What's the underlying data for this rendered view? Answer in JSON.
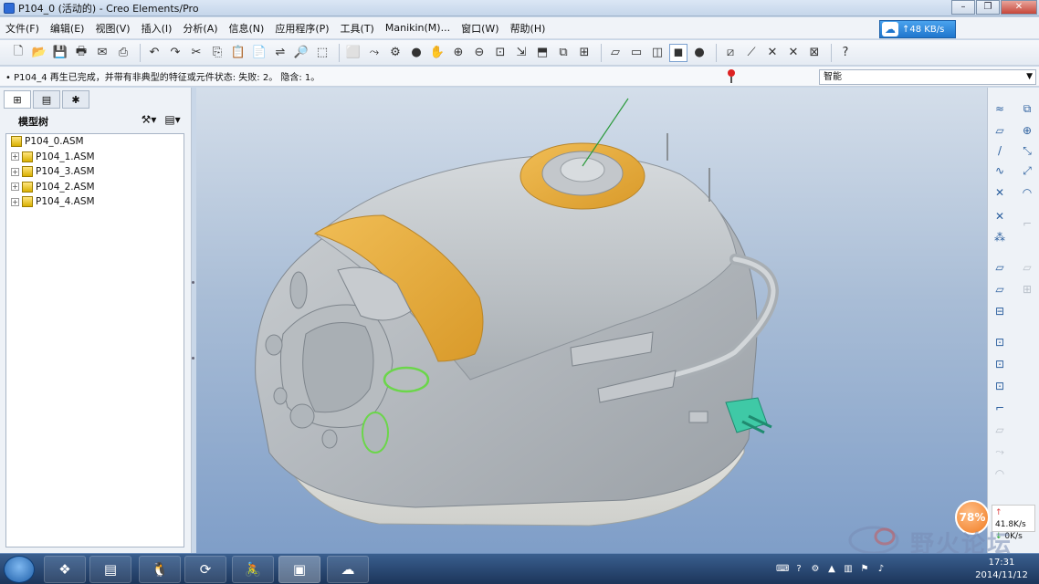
{
  "window": {
    "title": "P104_0 (活动的) - Creo Elements/Pro",
    "ghost_title": "一 □ × 文件 ... 帮助"
  },
  "menu": [
    "文件(F)",
    "编辑(E)",
    "视图(V)",
    "插入(I)",
    "分析(A)",
    "信息(N)",
    "应用程序(P)",
    "工具(T)",
    "Manikin(M)...",
    "窗口(W)",
    "帮助(H)"
  ],
  "net_widget": {
    "speed": "48 KB/s",
    "arrow": "↑"
  },
  "toolbar": {
    "buttons_a": [
      "🗋",
      "📂",
      "💾",
      "🖶",
      "✉",
      "⎙"
    ],
    "buttons_b": [
      "↶",
      "↷",
      "✂",
      "⎘",
      "📋",
      "📄",
      "⇌",
      "🔎",
      "⬚"
    ],
    "buttons_c": [
      "⬜",
      "⤳",
      "⚙",
      "●",
      "✋",
      "⊕",
      "⊖",
      "⊡",
      "⇲",
      "⬒",
      "⧉",
      "⊞"
    ],
    "buttons_d": [
      "▱",
      "▭",
      "◫",
      "◼",
      "●"
    ],
    "buttons_e": [
      "⧄",
      "⟋",
      "✕",
      "✕",
      "⊠",
      "?"
    ]
  },
  "status": {
    "message": "• P104_4 再生已完成，并带有非典型的特征或元件状态: 失败: 2。 隐含: 1。",
    "filter_value": "智能"
  },
  "model_tree": {
    "title": "模型树",
    "root": "P104_0.ASM",
    "children": [
      "P104_1.ASM",
      "P104_3.ASM",
      "P104_2.ASM",
      "P104_4.ASM"
    ]
  },
  "right_toolbar": {
    "col1": [
      "≈",
      "▱",
      "/",
      "∿",
      "✕",
      "✕",
      "⁂",
      "▱",
      "▱",
      "⊟",
      "⊡",
      "⊡",
      "⊡",
      "⌐",
      "▱",
      "⤳",
      "◠"
    ],
    "col2": [
      "⧉",
      "⊕",
      "⤡",
      "⤢",
      "◠",
      "⌐",
      "▱",
      "⊞"
    ]
  },
  "speed_widget": {
    "percent": "78%",
    "up": "41.8K/s",
    "down": "0K/s"
  },
  "watermark": {
    "text": "野火论坛"
  },
  "taskbar": {
    "apps": [
      "❖",
      "▤",
      "🐧",
      "⟳",
      "🚴",
      "▣",
      "☁"
    ],
    "clock_time": "17:31",
    "clock_date": "2014/11/12"
  },
  "colors": {
    "body_gray": "#b7bcc1",
    "accent_orange": "#e8ad3d",
    "base_white": "#e5e6e3",
    "selection_green": "#6bd64a",
    "plug_teal": "#3fc9a6"
  }
}
